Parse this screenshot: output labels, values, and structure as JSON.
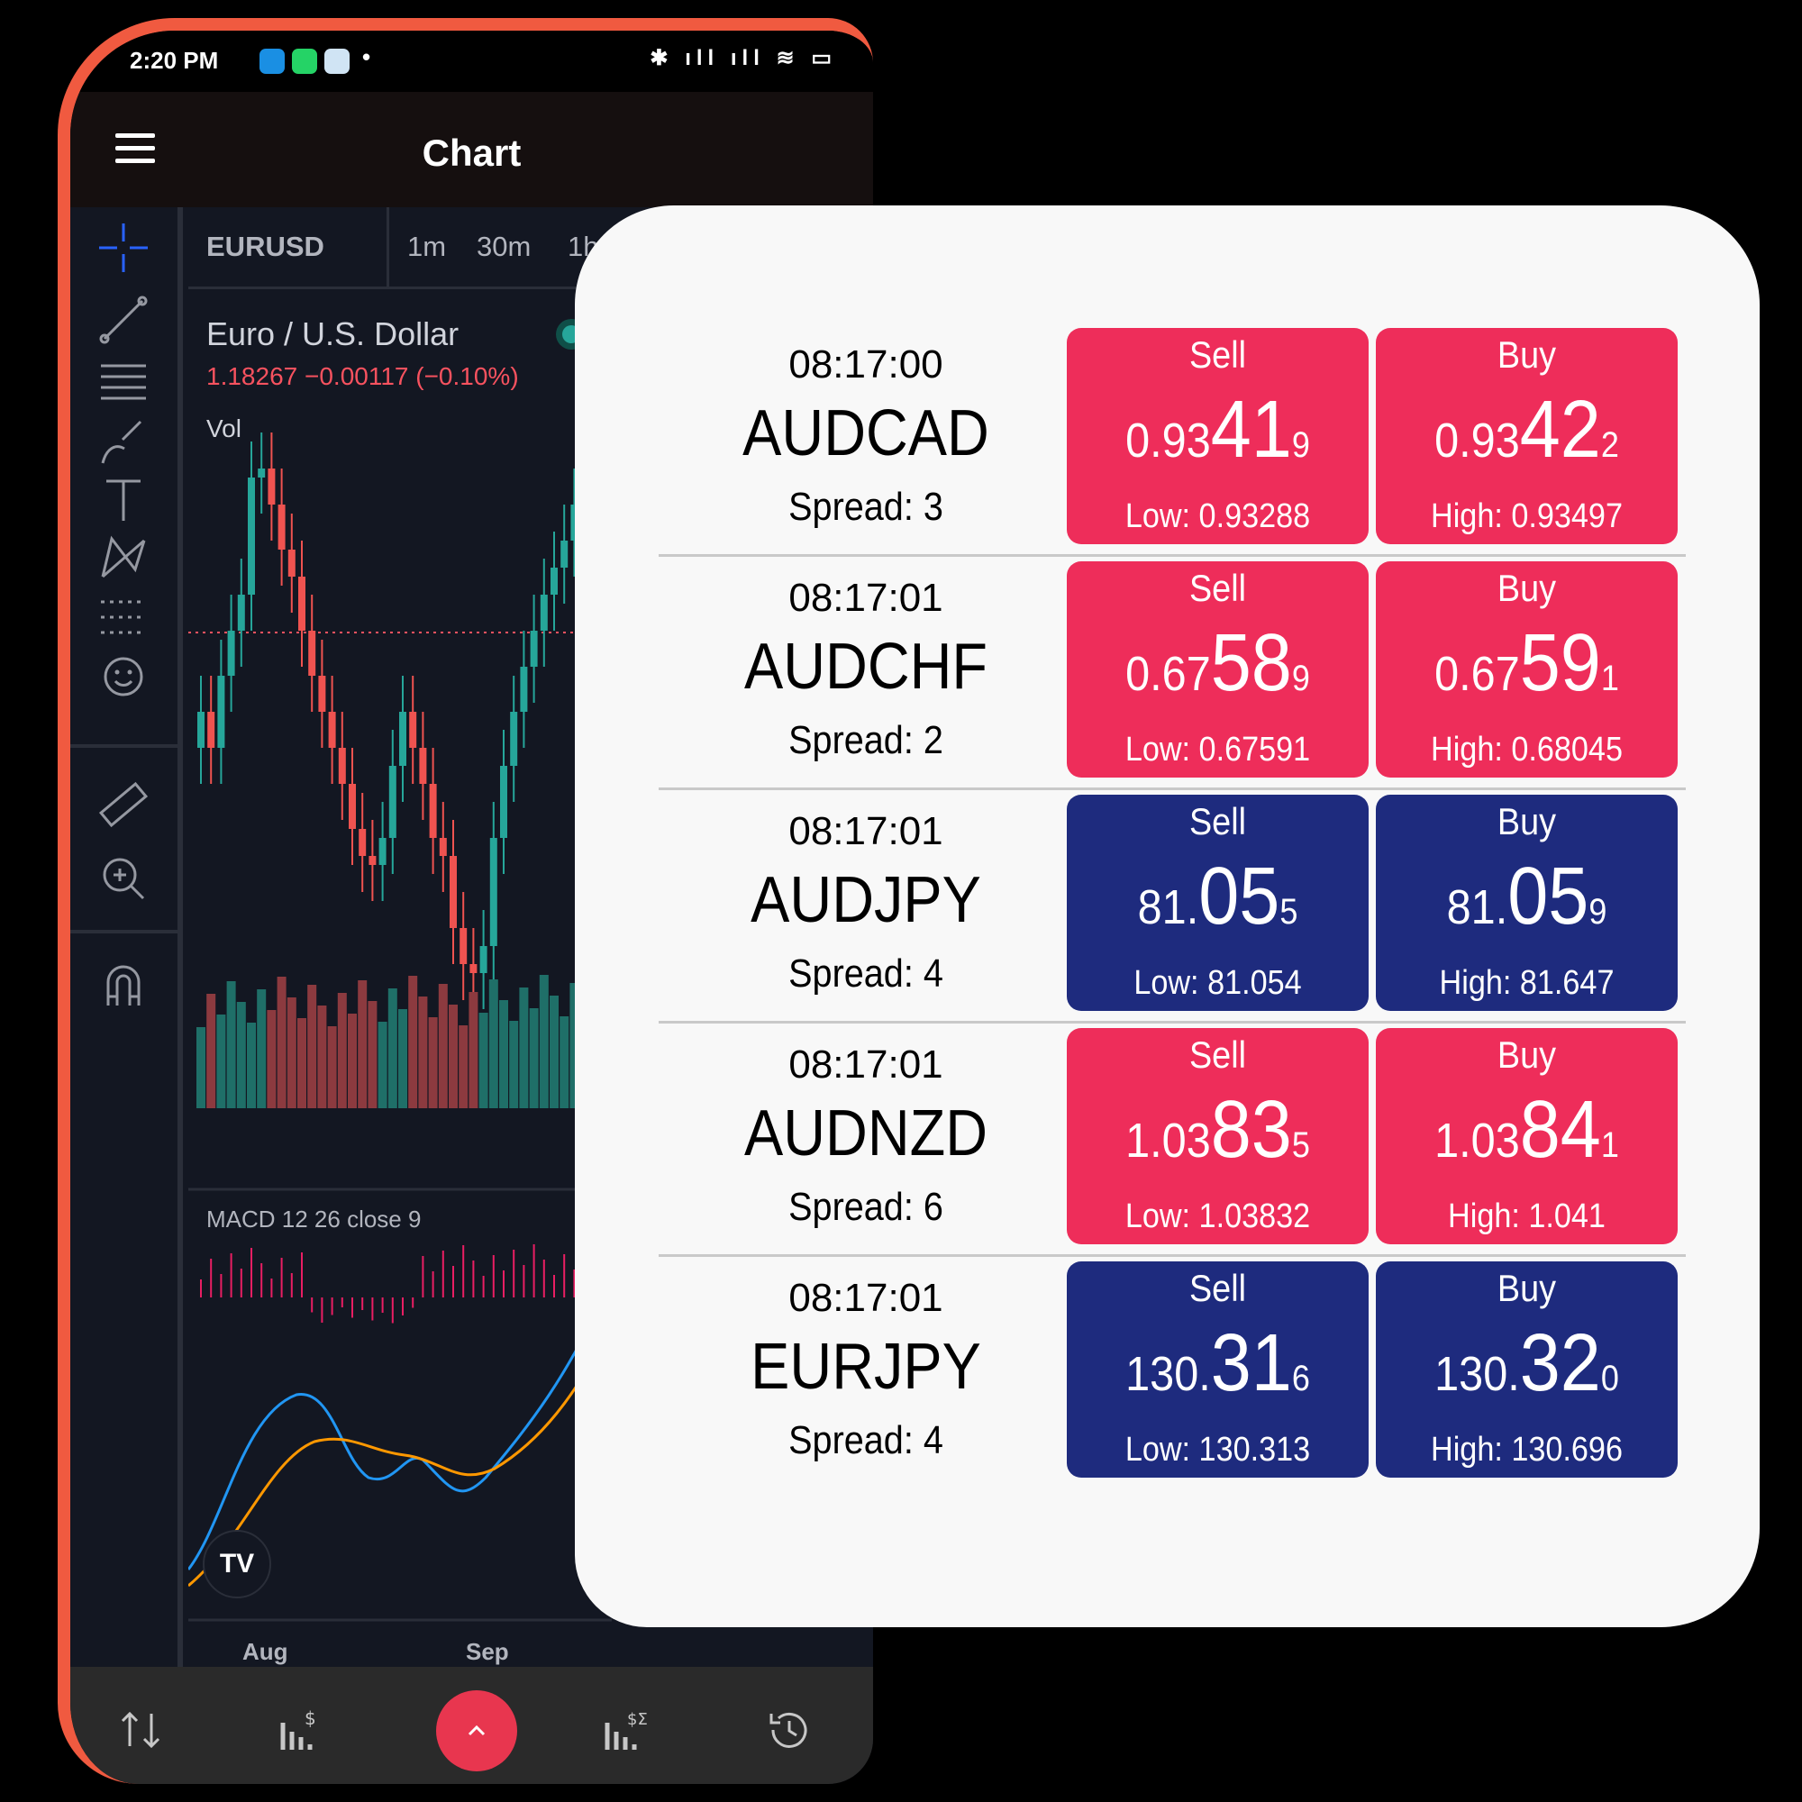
{
  "status_bar": {
    "time": "2:20 PM",
    "dot": "•",
    "right_icons": "✱ ıll ıll ≋ ▭"
  },
  "app_bar": {
    "title": "Chart"
  },
  "chart": {
    "symbol": "EURUSD",
    "timeframes": [
      "1m",
      "30m",
      "1h"
    ],
    "pair_name": "Euro / U.S. Dollar",
    "price_line": "1.18267  −0.00117 (−0.10%)",
    "vol_label": "Vol",
    "macd_label": "MACD 12 26 close 9",
    "x_labels": [
      "Aug",
      "Sep"
    ],
    "logo": "TV"
  },
  "quotes": [
    {
      "time": "08:17:00",
      "pair": "AUDCAD",
      "spread": "Spread: 3",
      "sell_label": "Sell",
      "buy_label": "Buy",
      "sell": {
        "prefix": "0.93",
        "big": "41",
        "pip": "9",
        "stat": "Low: 0.93288",
        "color": "#ee2d5a"
      },
      "buy": {
        "prefix": "0.93",
        "big": "42",
        "pip": "2",
        "stat": "High: 0.93497",
        "color": "#ee2d5a"
      }
    },
    {
      "time": "08:17:01",
      "pair": "AUDCHF",
      "spread": "Spread: 2",
      "sell_label": "Sell",
      "buy_label": "Buy",
      "sell": {
        "prefix": "0.67",
        "big": "58",
        "pip": "9",
        "stat": "Low: 0.67591",
        "color": "#ee2d5a"
      },
      "buy": {
        "prefix": "0.67",
        "big": "59",
        "pip": "1",
        "stat": "High: 0.68045",
        "color": "#ee2d5a"
      }
    },
    {
      "time": "08:17:01",
      "pair": "AUDJPY",
      "spread": "Spread: 4",
      "sell_label": "Sell",
      "buy_label": "Buy",
      "sell": {
        "prefix": "81.",
        "big": "05",
        "pip": "5",
        "stat": "Low: 81.054",
        "color": "#1e2b7e"
      },
      "buy": {
        "prefix": "81.",
        "big": "05",
        "pip": "9",
        "stat": "High: 81.647",
        "color": "#1e2b7e"
      }
    },
    {
      "time": "08:17:01",
      "pair": "AUDNZD",
      "spread": "Spread: 6",
      "sell_label": "Sell",
      "buy_label": "Buy",
      "sell": {
        "prefix": "1.03",
        "big": "83",
        "pip": "5",
        "stat": "Low: 1.03832",
        "color": "#ee2d5a"
      },
      "buy": {
        "prefix": "1.03",
        "big": "84",
        "pip": "1",
        "stat": "High: 1.041",
        "color": "#ee2d5a"
      }
    },
    {
      "time": "08:17:01",
      "pair": "EURJPY",
      "spread": "Spread: 4",
      "sell_label": "Sell",
      "buy_label": "Buy",
      "sell": {
        "prefix": "130.",
        "big": "31",
        "pip": "6",
        "stat": "Low: 130.313",
        "color": "#1e2b7e"
      },
      "buy": {
        "prefix": "130.",
        "big": "32",
        "pip": "0",
        "stat": "High: 130.696",
        "color": "#1e2b7e"
      }
    }
  ],
  "colors": {
    "up": "#26a69a",
    "down": "#ef5350",
    "sell_red": "#ee2d5a",
    "navy": "#1e2b7e",
    "accent": "#f05a40",
    "fab": "#e8364f"
  },
  "icons": {
    "tools": [
      "crosshair-icon",
      "trendline-icon",
      "fib-icon",
      "brush-icon",
      "text-icon",
      "pattern-icon",
      "prediction-icon",
      "emoji-icon",
      "ruler-icon",
      "zoom-in-icon",
      "magnet-icon"
    ],
    "nav": [
      "swap-icon",
      "bars-dollar-icon",
      "chevron-up-icon",
      "bars-sum-icon",
      "history-icon"
    ]
  }
}
